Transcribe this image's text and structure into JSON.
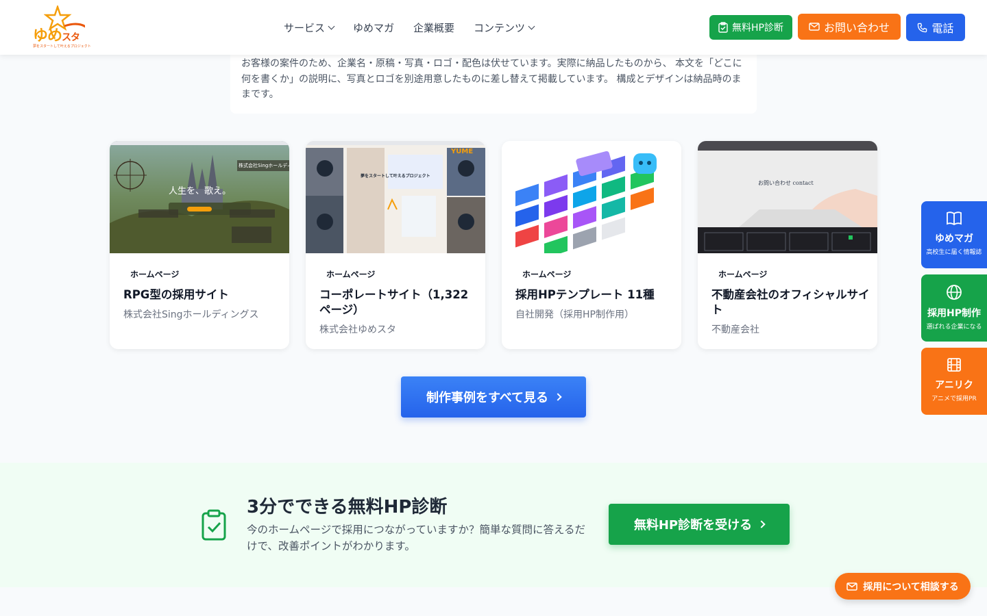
{
  "header": {
    "logo_text": "ゆめ",
    "logo_text_small": "スタ",
    "logo_sub": "夢をスタートして叶えるプロジェクト",
    "nav": [
      {
        "label": "サービス",
        "has_dropdown": true
      },
      {
        "label": "ゆめマガ",
        "has_dropdown": false
      },
      {
        "label": "企業概要",
        "has_dropdown": false
      },
      {
        "label": "コンテンツ",
        "has_dropdown": true
      }
    ],
    "btn_free_diag": "無料HP診断",
    "btn_contact": "お問い合わせ",
    "btn_phone": "電話"
  },
  "notice": {
    "text": "お客様の案件のため、企業名・原稿・写真・ロゴ・配色は伏せています。実際に納品したものから、 本文を「どこに何を書くか」の説明に、写真とロゴを別途用意したものに差し替えて掲載しています。 構成とデザインは納品時のままです。"
  },
  "cards": [
    {
      "tag": "ホームページ",
      "title": "RPG型の採用サイト",
      "company": "株式会社Singホールディングス",
      "img_caption": "人生を、歌え。",
      "img_corner": "株式会社Singホールディングス"
    },
    {
      "tag": "ホームページ",
      "title": "コーポレートサイト（1,322ページ）",
      "company": "株式会社ゆめスタ",
      "img_caption": "夢をスタートして叶えるプロジェクト",
      "img_corner": "YUME"
    },
    {
      "tag": "ホームページ",
      "title": "採用HPテンプレート 11種",
      "company": "自社開発（採用HP制作用）"
    },
    {
      "tag": "ホームページ",
      "title": "不動産会社のオフィシャルサイト",
      "company": "不動産会社",
      "img_caption": "お問い合わせ contact"
    }
  ],
  "cta": {
    "label": "制作事例をすべて見る"
  },
  "diagnosis": {
    "title": "3分でできる無料HP診断",
    "desc": "今のホームページで採用につながっていますか？簡単な質問に答えるだけで、改善ポイントがわかります。",
    "button": "無料HP診断を受ける"
  },
  "side_tabs": [
    {
      "label": "ゆめマガ",
      "sub": "高校生に届く情報誌",
      "color": "#2563eb",
      "icon": "book-icon"
    },
    {
      "label": "採用HP制作",
      "sub": "選ばれる企業になる",
      "color": "#16a34a",
      "icon": "globe-icon"
    },
    {
      "label": "アニリク",
      "sub": "アニメで採用PR",
      "color": "#f97316",
      "icon": "film-icon"
    }
  ],
  "floating": {
    "label": "採用について相談する"
  }
}
